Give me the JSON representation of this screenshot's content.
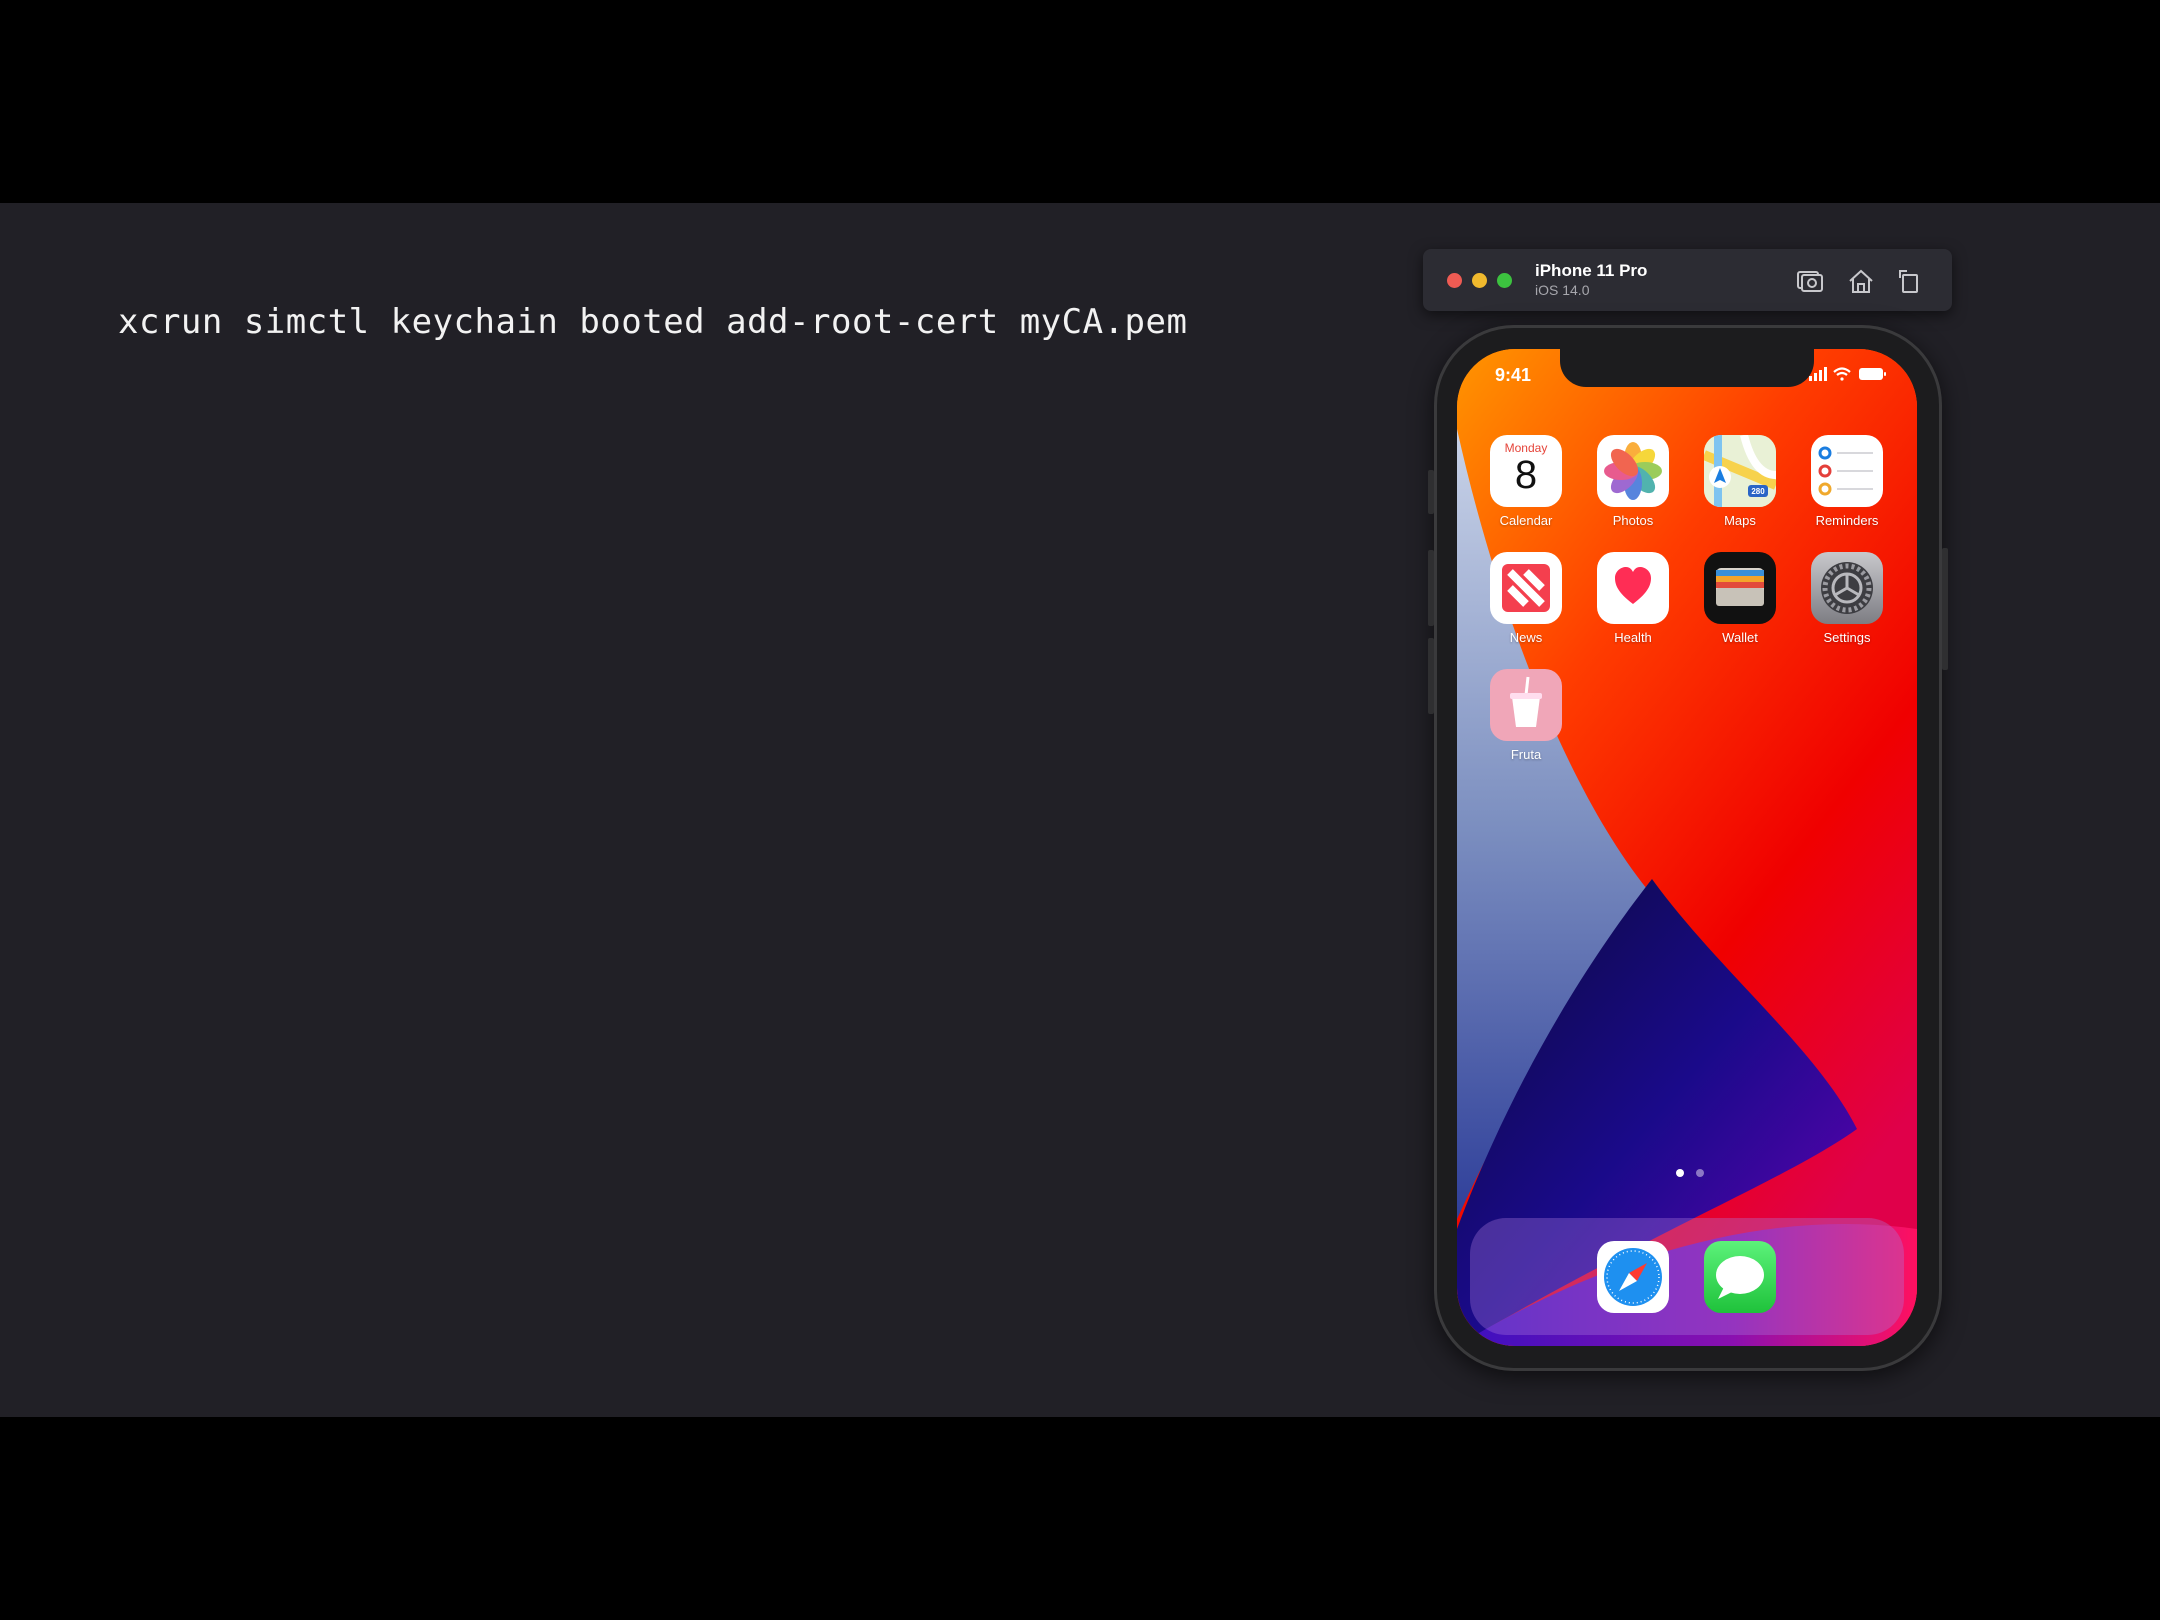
{
  "slide": {
    "command": "xcrun simctl keychain booted add-root-cert myCA.pem"
  },
  "simulator": {
    "device_name": "iPhone 11 Pro",
    "os_version": "iOS 14.0",
    "toolbar_icons": [
      "screenshot-icon",
      "home-icon",
      "rotate-icon"
    ]
  },
  "phone": {
    "time": "9:41",
    "calendar": {
      "day_name": "Monday",
      "day_number": "8"
    },
    "apps": [
      {
        "label": "Calendar",
        "icon": "calendar-icon"
      },
      {
        "label": "Photos",
        "icon": "photos-icon"
      },
      {
        "label": "Maps",
        "icon": "maps-icon"
      },
      {
        "label": "Reminders",
        "icon": "reminders-icon"
      },
      {
        "label": "News",
        "icon": "news-icon"
      },
      {
        "label": "Health",
        "icon": "health-icon"
      },
      {
        "label": "Wallet",
        "icon": "wallet-icon"
      },
      {
        "label": "Settings",
        "icon": "settings-icon"
      },
      {
        "label": "Fruta",
        "icon": "fruta-icon"
      }
    ],
    "maps_badge": "280",
    "dock": [
      "safari-icon",
      "messages-icon"
    ],
    "page_count": 2,
    "current_page": 1
  },
  "colors": {
    "slide_bg": "#212026",
    "letterbox": "#000000",
    "close": "#ee5b53",
    "minimize": "#f0b92d",
    "zoom": "#3cc23f"
  }
}
